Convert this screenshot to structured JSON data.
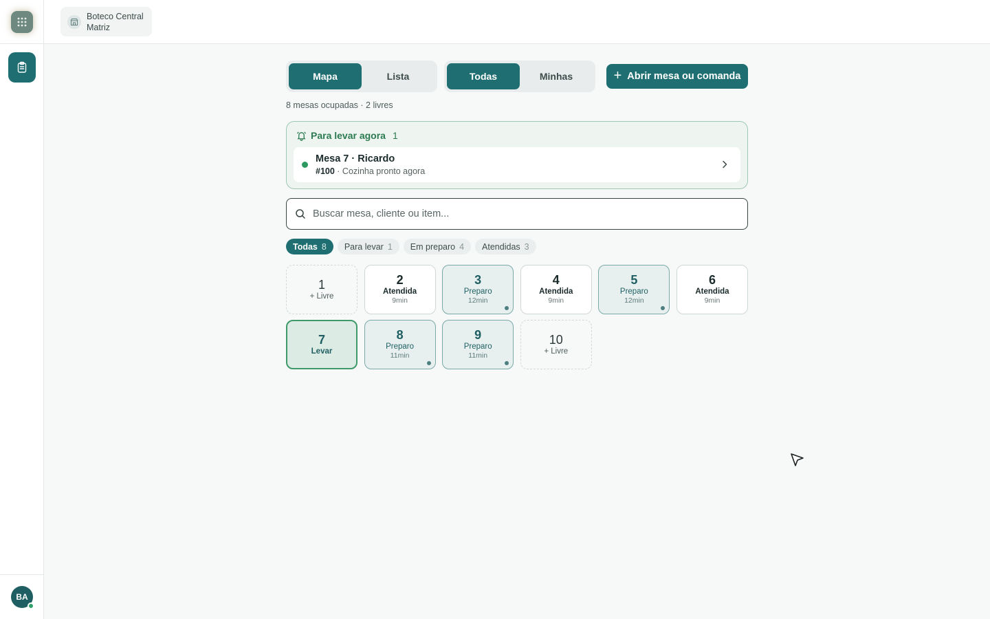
{
  "store": {
    "name": "Boteco Central",
    "branch": "Matriz"
  },
  "user": {
    "initials": "BA"
  },
  "view_toggle": {
    "map": "Mapa",
    "list": "Lista"
  },
  "scope_toggle": {
    "all": "Todas",
    "mine": "Minhas"
  },
  "new_button": {
    "plus": "+",
    "label": "Abrir mesa ou comanda"
  },
  "summary": "8 mesas ocupadas · 2 livres",
  "takeaway_alert": {
    "title": "Para levar agora",
    "count": "1",
    "item": {
      "title": "Mesa 7 · Ricardo",
      "order": "#100",
      "detail": "· Cozinha pronto agora"
    }
  },
  "search": {
    "placeholder": "Buscar mesa, cliente ou item..."
  },
  "filters": [
    {
      "label": "Todas",
      "count": "8"
    },
    {
      "label": "Para levar",
      "count": "1"
    },
    {
      "label": "Em preparo",
      "count": "4"
    },
    {
      "label": "Atendidas",
      "count": "3"
    }
  ],
  "tables": [
    {
      "number": "1",
      "status": "+ Livre",
      "time": ""
    },
    {
      "number": "2",
      "status": "Atendida",
      "time": "9min"
    },
    {
      "number": "3",
      "status": "Preparo",
      "time": "12min"
    },
    {
      "number": "4",
      "status": "Atendida",
      "time": "9min"
    },
    {
      "number": "5",
      "status": "Preparo",
      "time": "12min"
    },
    {
      "number": "6",
      "status": "Atendida",
      "time": "9min"
    },
    {
      "number": "7",
      "status": "Levar",
      "time": ""
    },
    {
      "number": "8",
      "status": "Preparo",
      "time": "11min"
    },
    {
      "number": "9",
      "status": "Preparo",
      "time": "11min"
    },
    {
      "number": "10",
      "status": "+ Livre",
      "time": ""
    }
  ],
  "colors": {
    "primary": "#1f6f72",
    "success": "#2e9a61",
    "alert_bg": "#eef5f1"
  }
}
